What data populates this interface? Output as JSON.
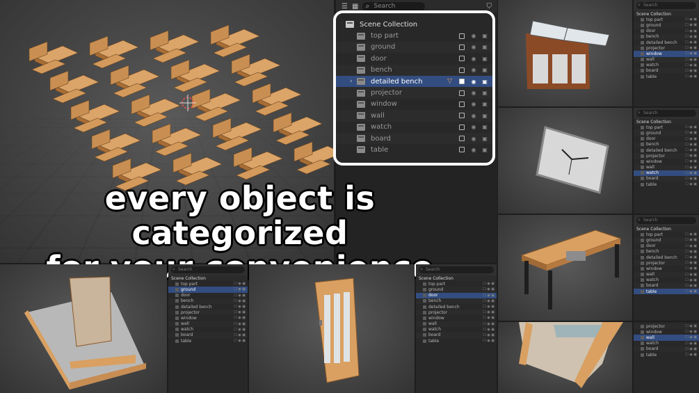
{
  "caption": {
    "line1": "every object is categorized",
    "line2": "for your convenience"
  },
  "main_outliner": {
    "search_placeholder": "Search",
    "root": "Scene Collection",
    "items": [
      {
        "label": "top part",
        "selected": false
      },
      {
        "label": "ground",
        "selected": false
      },
      {
        "label": "door",
        "selected": false
      },
      {
        "label": "bench",
        "selected": false
      },
      {
        "label": "detailed bench",
        "selected": true
      },
      {
        "label": "projector",
        "selected": false
      },
      {
        "label": "window",
        "selected": false
      },
      {
        "label": "wall",
        "selected": false
      },
      {
        "label": "watch",
        "selected": false
      },
      {
        "label": "board",
        "selected": false
      },
      {
        "label": "table",
        "selected": false
      }
    ]
  },
  "mini_outliners": {
    "search_placeholder": "Search",
    "root": "Scene Collection",
    "items": [
      "top part",
      "ground",
      "door",
      "bench",
      "detailed bench",
      "projector",
      "window",
      "wall",
      "watch",
      "board",
      "table"
    ],
    "bottom_left_selected": "ground",
    "bottom_mid_selected": "door",
    "right1_selected": "window",
    "right2_selected": "watch",
    "right3_selected": "table",
    "right4_items": [
      "projector",
      "window",
      "wall",
      "watch",
      "board",
      "table"
    ],
    "right4_selected": "wall"
  },
  "colors": {
    "accent_selected": "#334d80",
    "wood": "#d9a062",
    "outline_text": "#ffffff"
  },
  "icons": {
    "collection": "collection-icon",
    "visibility": "eye-icon",
    "render": "camera-icon",
    "filter": "funnel-icon"
  }
}
